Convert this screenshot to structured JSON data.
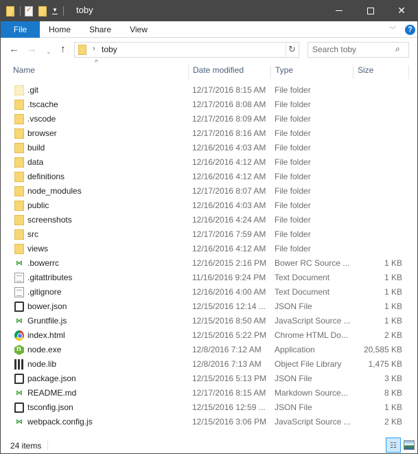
{
  "window": {
    "title": "toby",
    "controls": {
      "minimize": "minimize",
      "maximize": "maximize",
      "close": "✕"
    }
  },
  "ribbon": {
    "tabs": [
      {
        "label": "File",
        "active": true
      },
      {
        "label": "Home"
      },
      {
        "label": "Share"
      },
      {
        "label": "View"
      }
    ],
    "help_label": "?",
    "accent_color": "#1979ca"
  },
  "nav": {
    "back": "←",
    "forward": "→",
    "recent": "⌄",
    "up": "↑",
    "breadcrumb_chevron": "›",
    "path": "toby",
    "refresh": "↻",
    "search_placeholder": "Search toby",
    "search_icon": "⚲"
  },
  "columns": {
    "sort_indicator": "^",
    "name": "Name",
    "date": "Date modified",
    "type": "Type",
    "size": "Size"
  },
  "files": [
    {
      "name": ".git",
      "date": "12/17/2016 8:15 AM",
      "type": "File folder",
      "size": "",
      "icon": "folder-hidden-icon"
    },
    {
      "name": ".tscache",
      "date": "12/17/2016 8:08 AM",
      "type": "File folder",
      "size": "",
      "icon": "folder-icon"
    },
    {
      "name": ".vscode",
      "date": "12/17/2016 8:09 AM",
      "type": "File folder",
      "size": "",
      "icon": "folder-icon"
    },
    {
      "name": "browser",
      "date": "12/17/2016 8:16 AM",
      "type": "File folder",
      "size": "",
      "icon": "folder-icon"
    },
    {
      "name": "build",
      "date": "12/16/2016 4:03 AM",
      "type": "File folder",
      "size": "",
      "icon": "folder-icon"
    },
    {
      "name": "data",
      "date": "12/16/2016 4:12 AM",
      "type": "File folder",
      "size": "",
      "icon": "folder-icon"
    },
    {
      "name": "definitions",
      "date": "12/16/2016 4:12 AM",
      "type": "File folder",
      "size": "",
      "icon": "folder-icon"
    },
    {
      "name": "node_modules",
      "date": "12/17/2016 8:07 AM",
      "type": "File folder",
      "size": "",
      "icon": "folder-icon"
    },
    {
      "name": "public",
      "date": "12/16/2016 4:03 AM",
      "type": "File folder",
      "size": "",
      "icon": "folder-icon"
    },
    {
      "name": "screenshots",
      "date": "12/16/2016 4:24 AM",
      "type": "File folder",
      "size": "",
      "icon": "folder-icon"
    },
    {
      "name": "src",
      "date": "12/17/2016 7:59 AM",
      "type": "File folder",
      "size": "",
      "icon": "folder-icon"
    },
    {
      "name": "views",
      "date": "12/16/2016 4:12 AM",
      "type": "File folder",
      "size": "",
      "icon": "folder-icon"
    },
    {
      "name": ".bowerrc",
      "date": "12/16/2015 2:16 PM",
      "type": "Bower RC Source ...",
      "size": "1 KB",
      "icon": "vscode-file-icon"
    },
    {
      "name": ".gitattributes",
      "date": "11/16/2016 9:24 PM",
      "type": "Text Document",
      "size": "1 KB",
      "icon": "text-document-icon"
    },
    {
      "name": ".gitignore",
      "date": "12/16/2016 4:00 AM",
      "type": "Text Document",
      "size": "1 KB",
      "icon": "text-document-icon"
    },
    {
      "name": "bower.json",
      "date": "12/15/2016 12:14 ...",
      "type": "JSON File",
      "size": "1 KB",
      "icon": "json-file-icon"
    },
    {
      "name": "Gruntfile.js",
      "date": "12/15/2016 8:50 AM",
      "type": "JavaScript Source ...",
      "size": "1 KB",
      "icon": "vscode-file-icon"
    },
    {
      "name": "index.html",
      "date": "12/15/2016 5:22 PM",
      "type": "Chrome HTML Do...",
      "size": "2 KB",
      "icon": "chrome-icon"
    },
    {
      "name": "node.exe",
      "date": "12/8/2016 7:12 AM",
      "type": "Application",
      "size": "20,585 KB",
      "icon": "nodejs-icon"
    },
    {
      "name": "node.lib",
      "date": "12/8/2016 7:13 AM",
      "type": "Object File Library",
      "size": "1,475 KB",
      "icon": "library-icon"
    },
    {
      "name": "package.json",
      "date": "12/15/2016 5:13 PM",
      "type": "JSON File",
      "size": "3 KB",
      "icon": "json-file-icon"
    },
    {
      "name": "README.md",
      "date": "12/17/2016 8:15 AM",
      "type": "Markdown Source...",
      "size": "8 KB",
      "icon": "vscode-file-icon"
    },
    {
      "name": "tsconfig.json",
      "date": "12/15/2016 12:59 ...",
      "type": "JSON File",
      "size": "1 KB",
      "icon": "json-file-icon"
    },
    {
      "name": "webpack.config.js",
      "date": "12/15/2016 3:06 PM",
      "type": "JavaScript Source ...",
      "size": "2 KB",
      "icon": "vscode-file-icon"
    }
  ],
  "status": {
    "item_count": "24 items",
    "view_details_glyph": "☷"
  }
}
